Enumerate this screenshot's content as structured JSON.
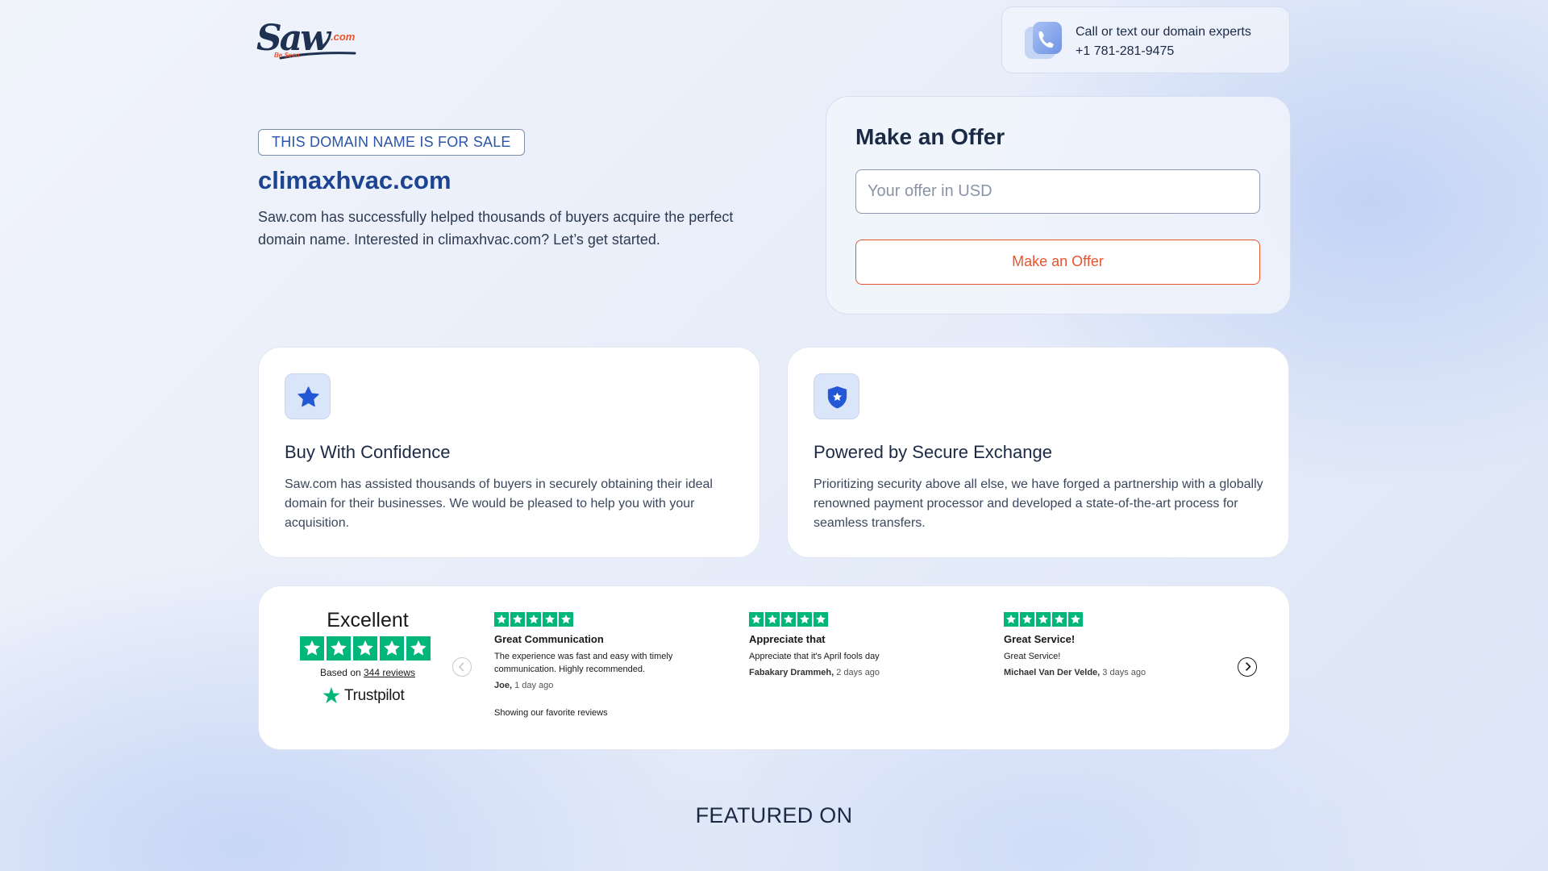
{
  "brand": {
    "logo_main": "Saw",
    "logo_suffix": ".com",
    "logo_tagline": "Be Seen"
  },
  "contact": {
    "line1": "Call or text our domain experts",
    "phone": "+1 781-281-9475"
  },
  "hero": {
    "badge": "THIS DOMAIN NAME IS FOR SALE",
    "domain": "climaxhvac.com",
    "description": "Saw.com has successfully helped thousands of buyers acquire the perfect domain name. Interested in climaxhvac.com? Let’s get started."
  },
  "offer": {
    "title": "Make an Offer",
    "input_placeholder": "Your offer in USD",
    "input_value": "",
    "button_label": "Make an Offer"
  },
  "features": [
    {
      "icon": "star-icon",
      "title": "Buy With Confidence",
      "description": "Saw.com has assisted thousands of buyers in securely obtaining their ideal domain for their businesses. We would be pleased to help you with your acquisition."
    },
    {
      "icon": "shield-icon",
      "title": "Powered by Secure Exchange",
      "description": "Prioritizing security above all else, we have forged a partnership with a globally renowned payment processor and developed a state-of-the-art process for seamless transfers."
    }
  ],
  "trustpilot": {
    "rating_word": "Excellent",
    "stars": 5,
    "based_on_prefix": "Based on ",
    "review_count_link": "344 reviews",
    "logo_text": "Trustpilot",
    "showing_text": "Showing our favorite reviews",
    "reviews": [
      {
        "stars": 5,
        "title": "Great Communication",
        "body": "The experience was fast and easy with timely communication. Highly recommended.",
        "author": "Joe,",
        "time": " 1 day ago"
      },
      {
        "stars": 5,
        "title": "Appreciate that",
        "body": "Appreciate that it's April fools day",
        "author": "Fabakary Drammeh,",
        "time": " 2 days ago"
      },
      {
        "stars": 5,
        "title": "Great Service!",
        "body": "Great Service!",
        "author": "Michael Van Der Velde,",
        "time": " 3 days ago"
      }
    ],
    "prev_icon": "chevron-left-icon",
    "next_icon": "chevron-right-icon"
  },
  "featured": {
    "heading": "FEATURED ON"
  },
  "colors": {
    "accent_orange": "#e8542e",
    "brand_blue": "#1d4391",
    "trustpilot_green": "#00b67a"
  }
}
